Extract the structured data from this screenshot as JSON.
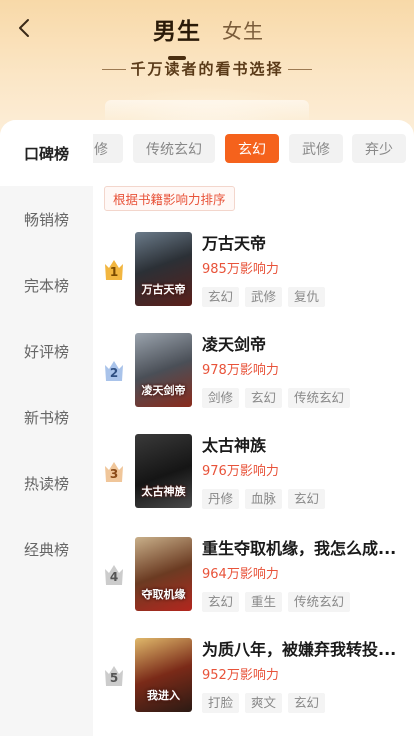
{
  "header": {
    "tabs": [
      {
        "label": "男生",
        "active": true
      },
      {
        "label": "女生",
        "active": false
      }
    ],
    "subtitle": "千万读者的看书选择"
  },
  "sidebar": {
    "items": [
      {
        "label": "口碑榜",
        "active": true
      },
      {
        "label": "畅销榜",
        "active": false
      },
      {
        "label": "完本榜",
        "active": false
      },
      {
        "label": "好评榜",
        "active": false
      },
      {
        "label": "新书榜",
        "active": false
      },
      {
        "label": "热读榜",
        "active": false
      },
      {
        "label": "经典榜",
        "active": false
      }
    ]
  },
  "genres": [
    {
      "label": "修",
      "active": false
    },
    {
      "label": "传统玄幻",
      "active": false
    },
    {
      "label": "玄幻",
      "active": true
    },
    {
      "label": "武修",
      "active": false
    },
    {
      "label": "弃少",
      "active": false
    }
  ],
  "sort_hint": "根据书籍影响力排序",
  "books": [
    {
      "rank": "1",
      "title": "万古天帝",
      "cover_text": "万古天帝",
      "influence": "985万影响力",
      "tags": [
        "玄幻",
        "武修",
        "复仇"
      ]
    },
    {
      "rank": "2",
      "title": "凌天剑帝",
      "cover_text": "凌天剑帝",
      "influence": "978万影响力",
      "tags": [
        "剑修",
        "玄幻",
        "传统玄幻"
      ]
    },
    {
      "rank": "3",
      "title": "太古神族",
      "cover_text": "太古神族",
      "influence": "976万影响力",
      "tags": [
        "丹修",
        "血脉",
        "玄幻"
      ]
    },
    {
      "rank": "4",
      "title": "重生夺取机缘，我怎么成...",
      "cover_text": "夺取机缘",
      "influence": "964万影响力",
      "tags": [
        "玄幻",
        "重生",
        "传统玄幻"
      ]
    },
    {
      "rank": "5",
      "title": "为质八年，被嫌弃我转投...",
      "cover_text": "我进入",
      "influence": "952万影响力",
      "tags": [
        "打脸",
        "爽文",
        "玄幻"
      ]
    }
  ],
  "colors": {
    "accent": "#f5621c",
    "influence": "#e8533a",
    "rank1": "#f2b640",
    "rank2": "#a9c3ea",
    "rank3": "#f0c69a",
    "rank_other": "#cccccc"
  },
  "icons": {
    "back": "chevron-left-icon",
    "rank": "crown-icon"
  }
}
